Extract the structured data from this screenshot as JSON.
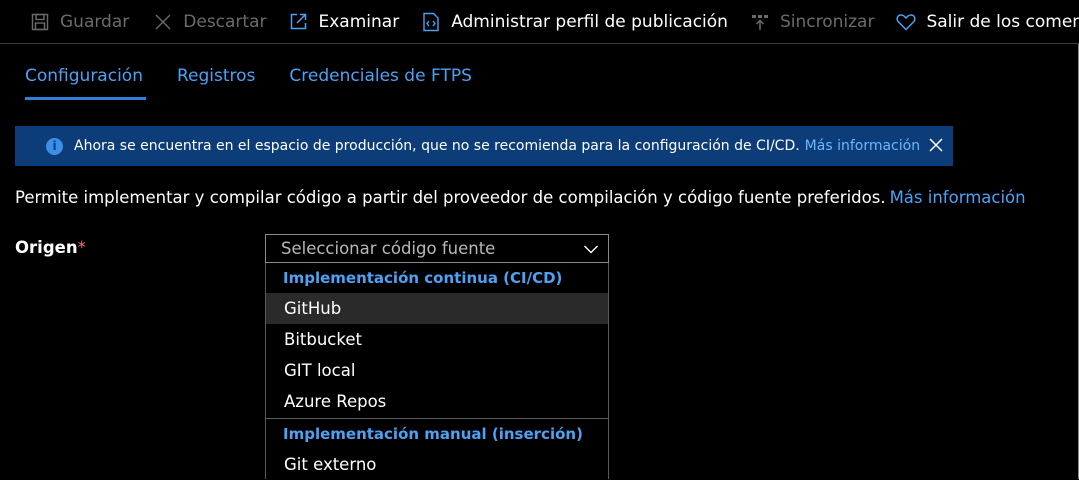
{
  "toolbar": {
    "save_label": "Guardar",
    "discard_label": "Descartar",
    "browse_label": "Examinar",
    "manage_profile_label": "Administrar perfil de publicación",
    "sync_label": "Sincronizar",
    "feedback_label": "Salir de los comentarios"
  },
  "tabs": [
    {
      "label": "Configuración",
      "active": true
    },
    {
      "label": "Registros",
      "active": false
    },
    {
      "label": "Credenciales de FTPS",
      "active": false
    }
  ],
  "banner": {
    "message": "Ahora se encuentra en el espacio de producción, que no se recomienda para la configuración de CI/CD.",
    "link": "Más información"
  },
  "description": {
    "text": "Permite implementar y compilar código a partir del proveedor de compilación y código fuente preferidos.",
    "link": "Más información"
  },
  "source": {
    "label": "Origen",
    "required_mark": "*",
    "placeholder": "Seleccionar código fuente"
  },
  "dropdown": {
    "ci_header": "Implementación continua (CI/CD)",
    "ci_items": [
      "GitHub",
      "Bitbucket",
      "GIT local",
      "Azure Repos"
    ],
    "manual_header": "Implementación manual (inserción)",
    "manual_items": [
      "Git externo"
    ]
  },
  "colors": {
    "accent": "#4ea1f3",
    "banner_bg": "#0d3d78",
    "required": "#f1707b"
  }
}
